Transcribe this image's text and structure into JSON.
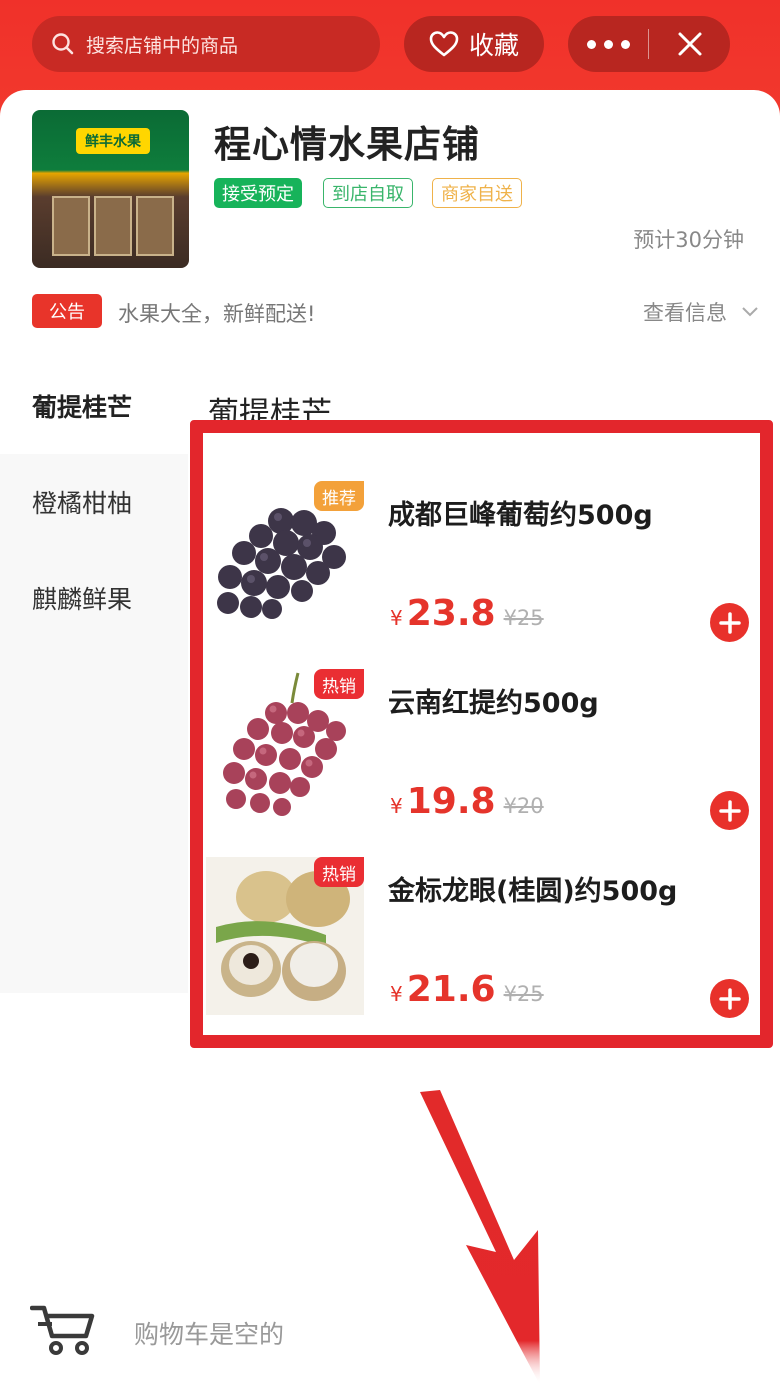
{
  "header": {
    "search_placeholder": "搜索店铺中的商品",
    "favorite_label": "收藏"
  },
  "shop": {
    "name": "程心情水果店铺",
    "sign_text": "鲜丰水果",
    "tags": [
      "接受预定",
      "到店自取",
      "商家自送"
    ],
    "eta": "预计30分钟",
    "notice_badge": "公告",
    "notice_text": "水果大全，新鲜配送!",
    "info_link": "查看信息"
  },
  "sidebar": {
    "items": [
      {
        "label": "葡提桂芒",
        "active": true
      },
      {
        "label": "橙橘柑柚",
        "active": false
      },
      {
        "label": "麒麟鲜果",
        "active": false
      }
    ]
  },
  "category_heading": "葡提桂芒",
  "products": [
    {
      "name": "成都巨峰葡萄约500g",
      "badge": "推荐",
      "currency": "¥",
      "price": "23.8",
      "original_price": "¥25",
      "image": "dark-grapes"
    },
    {
      "name": "云南红提约500g",
      "badge": "热销",
      "currency": "¥",
      "price": "19.8",
      "original_price": "¥20",
      "image": "red-grapes"
    },
    {
      "name": "金标龙眼(桂圆)约500g",
      "badge": "热销",
      "currency": "¥",
      "price": "21.6",
      "original_price": "¥25",
      "image": "longan"
    }
  ],
  "cart": {
    "empty_text": "购物车是空的"
  },
  "colors": {
    "brand_red": "#e8312b",
    "tag_green": "#17b35a",
    "tag_orange": "#efb24a",
    "highlight_border": "#e3262c"
  }
}
